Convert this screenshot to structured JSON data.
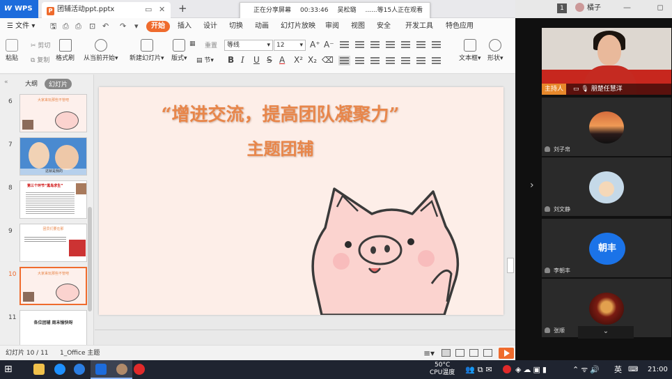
{
  "titlebar": {
    "app": "WPS",
    "doc_tab": "团辅活动ppt.pptx",
    "new_tab": "+",
    "sharing": {
      "status": "正在分享屏幕",
      "time": "00:33:46",
      "presenter": "吴松璐",
      "viewers": "......等15人正在观看"
    },
    "page_badge": "1",
    "user": "橘子",
    "window_buttons": "— ◻ ✕"
  },
  "menu": {
    "file": "文件",
    "start": "开始",
    "items": [
      "插入",
      "设计",
      "切换",
      "动画",
      "幻灯片放映",
      "审阅",
      "视图",
      "安全",
      "开发工具",
      "特色应用"
    ]
  },
  "ribbon": {
    "paste": "粘贴",
    "cut": "剪切",
    "copy": "复制",
    "format_painter": "格式刷",
    "play_from_current": "从当前开始",
    "new_slide": "新建幻灯片",
    "layout": "版式",
    "section": "节",
    "reset": "重置",
    "font": "等线",
    "size": "12",
    "textbox": "文本框",
    "shape": "形状"
  },
  "left_panel": {
    "tab_outline": "大纲",
    "tab_slides": "幻灯片",
    "thumbs": [
      {
        "num": "6",
        "text": "大家来玩那些不管吧"
      },
      {
        "num": "7",
        "text": "这就是我的"
      },
      {
        "num": "8",
        "text": "第三个环节“黑岛求生”"
      },
      {
        "num": "9",
        "text": "团员们要在那"
      },
      {
        "num": "10",
        "text": "大家来玩那些不管吧"
      },
      {
        "num": "11",
        "text": "各位团辅 周末愉快呀"
      }
    ]
  },
  "slide": {
    "title": "“增进交流，提高团队凝聚力”",
    "subtitle": "主题团辅"
  },
  "status": {
    "slide_count": "幻灯片 10 / 11",
    "theme": "1_Office 主题"
  },
  "meeting": {
    "host_tag": "主持人",
    "host_name": "朋楚任慧洋",
    "participants": [
      {
        "name": "刘子帛"
      },
      {
        "name": "刘文静"
      },
      {
        "name": "李朝丰",
        "avatar_text": "朝丰"
      },
      {
        "name": "张顺"
      }
    ]
  },
  "taskbar": {
    "temp": "50°C",
    "cpu": "CPU温度",
    "ime": "英",
    "clock": "21:00"
  }
}
